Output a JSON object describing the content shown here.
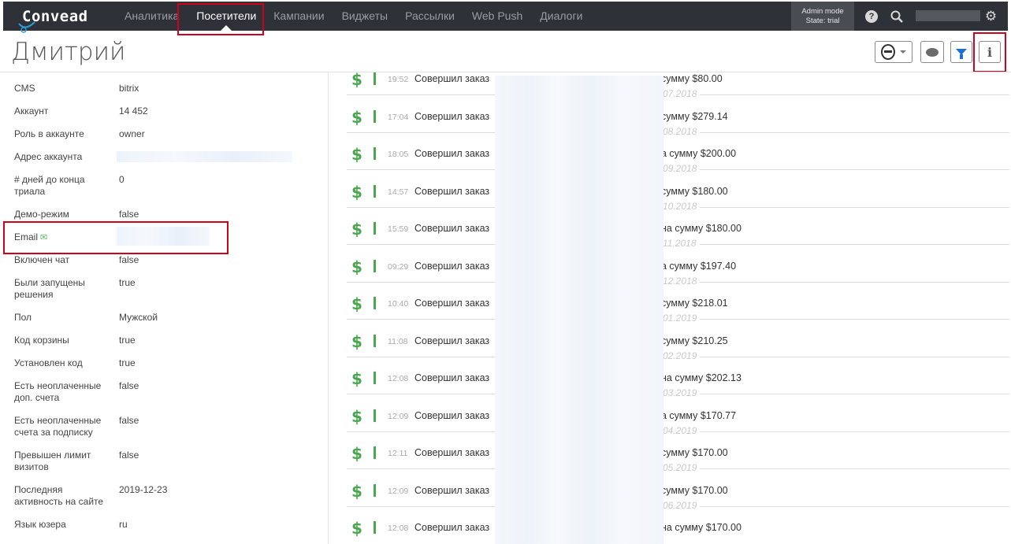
{
  "app": {
    "logo": "Convead",
    "nav": [
      {
        "label": "Аналитика"
      },
      {
        "label": "Посетители",
        "active": true
      },
      {
        "label": "Кампании"
      },
      {
        "label": "Виджеты"
      },
      {
        "label": "Рассылки"
      },
      {
        "label": "Web Push"
      },
      {
        "label": "Диалоги"
      }
    ],
    "admin_mode": "Admin mode",
    "admin_state": "State: trial",
    "help_icon": "question-circle-icon",
    "search_icon": "search-icon",
    "gear_icon": "gear-icon",
    "accent": "#d0021b",
    "navbar_color": "#2f3138"
  },
  "header": {
    "title": "Дмитрий",
    "info_glyph": "i",
    "buttons": [
      "avatar-icon",
      "chat-icon",
      "filter-icon",
      "info-icon"
    ]
  },
  "properties": [
    {
      "key": "CMS",
      "value": "bitrix"
    },
    {
      "key": "Аккаунт",
      "value": "14 452"
    },
    {
      "key": "Роль в аккаунте",
      "value": "owner"
    },
    {
      "key": "Адрес аккаунта",
      "value": ""
    },
    {
      "key": "# дней до конца триала",
      "value": "0"
    },
    {
      "key": "Демо-режим",
      "value": "false"
    },
    {
      "key": "Email",
      "value": ""
    },
    {
      "key": "Включен чат",
      "value": "false"
    },
    {
      "key": "Были запущены решения",
      "value": "true"
    },
    {
      "key": "Пол",
      "value": "Мужской"
    },
    {
      "key": "Код корзины",
      "value": "true"
    },
    {
      "key": "Установлен код",
      "value": "true"
    },
    {
      "key": "Есть неоплаченные доп. счета",
      "value": "false"
    },
    {
      "key": "Есть неоплаченные счета за подписку",
      "value": "false"
    },
    {
      "key": "Превышен лимит визитов",
      "value": "false"
    },
    {
      "key": "Последняя активность на сайте",
      "value": "2019-12-23"
    },
    {
      "key": "Язык юзера",
      "value": "ru"
    }
  ],
  "timeline": {
    "action": "Совершил заказ",
    "events": [
      {
        "time": "19:52",
        "amount": "сумму $80.00",
        "date_after": "07.2018"
      },
      {
        "time": "17:04",
        "amount": "сумму $279.14",
        "date_after": "08.2018"
      },
      {
        "time": "18:05",
        "amount": "а сумму $200.00",
        "date_after": "09.2018"
      },
      {
        "time": "14:57",
        "amount": " сумму $180.00",
        "date_after": "10.2018"
      },
      {
        "time": "15:59",
        "amount": "на сумму $180.00",
        "date_after": "11.2018"
      },
      {
        "time": "09:29",
        "amount": "а сумму $197.40",
        "date_after": "12.2018"
      },
      {
        "time": "10:40",
        "amount": "сумму $218.01",
        "date_after": "01.2019"
      },
      {
        "time": "11:08",
        "amount": " сумму $210.25",
        "date_after": "02.2019"
      },
      {
        "time": "12:08",
        "amount": "на сумму $202.13",
        "date_after": "03.2019"
      },
      {
        "time": "12:09",
        "amount": "а сумму $170.77",
        "date_after": "04.2019"
      },
      {
        "time": "12:11",
        "amount": "сумму $170.00",
        "date_after": "05.2019"
      },
      {
        "time": "12:09",
        "amount": "сумму $170.00",
        "date_after": "06.2019"
      },
      {
        "time": "12:08",
        "amount": "на сумму $170.00",
        "date_after": ""
      }
    ]
  }
}
